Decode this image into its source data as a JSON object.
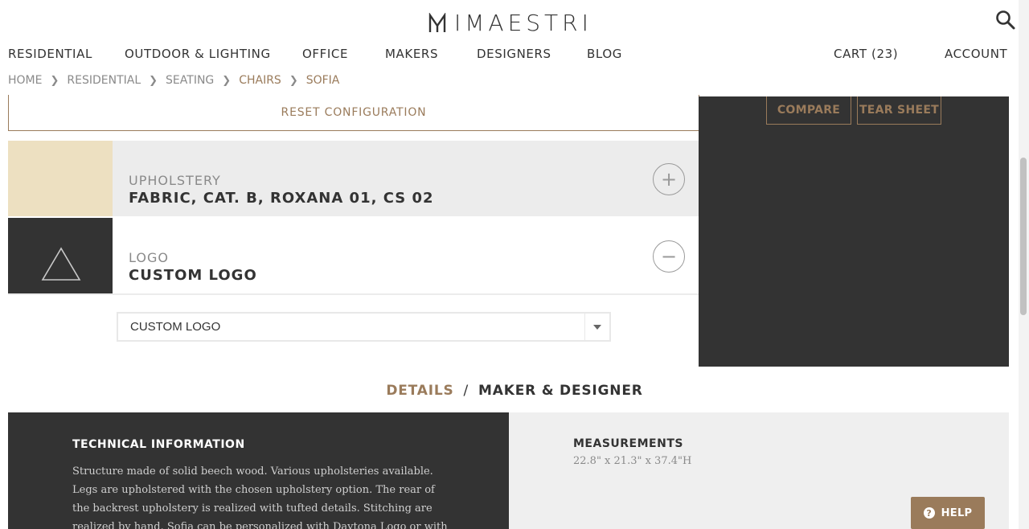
{
  "brand": {
    "logo_text": "IMAESTRI"
  },
  "nav": {
    "items": [
      {
        "label": "RESIDENTIAL"
      },
      {
        "label": "OUTDOOR & LIGHTING"
      },
      {
        "label": "OFFICE"
      },
      {
        "label": "MAKERS"
      },
      {
        "label": "DESIGNERS"
      },
      {
        "label": "BLOG"
      }
    ],
    "cart": "CART (23)",
    "account": "ACCOUNT"
  },
  "breadcrumb": [
    "HOME",
    "RESIDENTIAL",
    "SEATING",
    "CHAIRS",
    "SOFIA"
  ],
  "config": {
    "reset_label": "RESET CONFIGURATION",
    "upholstery": {
      "label": "UPHOLSTERY",
      "value": "FABRIC, CAT. B, ROXANA 01, CS 02",
      "toggle": "+"
    },
    "logo": {
      "label": "LOGO",
      "value": "CUSTOM LOGO",
      "toggle": "−"
    },
    "select": {
      "value": "CUSTOM LOGO"
    }
  },
  "preview": {
    "compare": "COMPARE",
    "tear_sheet": "TEAR SHEET"
  },
  "tabs": {
    "details": "DETAILS",
    "separator": "/",
    "maker": "MAKER & DESIGNER"
  },
  "technical": {
    "title": "TECHNICAL INFORMATION",
    "text": "Structure made of solid beech wood. Various upholsteries available. Legs are upholstered with the chosen upholstery option. The rear of the backrest upholstery is realized with tufted details. Stitching are realized by hand. Sofia can be personalized with Daytona Logo or with Custom Logo; Daytona will verify the"
  },
  "measurements": {
    "title": "MEASUREMENTS",
    "value": "22.8\" x 21.3\" x 37.4\"H"
  },
  "help": {
    "label": "HELP"
  },
  "colors": {
    "accent": "#9a7b5b",
    "dark": "#333333",
    "light_panel": "#efefef",
    "upholstery_swatch": "#ede0c1"
  },
  "icons": {
    "search": "search-icon",
    "chevron": "chevron-right-icon",
    "plus": "plus-icon",
    "minus": "minus-icon",
    "logo_placeholder": "triangle-icon",
    "dropdown": "chevron-down-icon",
    "help": "question-icon"
  }
}
